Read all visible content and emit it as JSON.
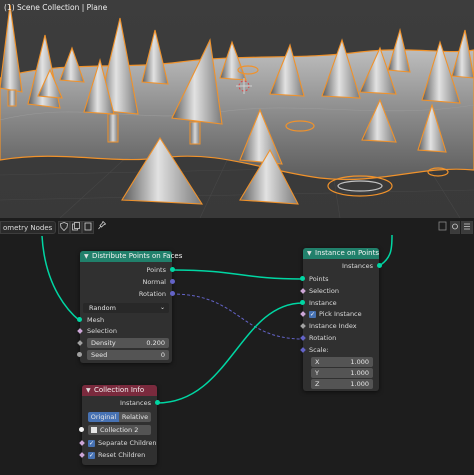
{
  "viewport": {
    "title": "(1) Scene Collection | Plane"
  },
  "node_header": {
    "tree_name": "ometry Nodes",
    "buttons": [
      "shield-icon",
      "copy-icon",
      "new-icon",
      "pin-icon"
    ]
  },
  "nodes": {
    "distribute": {
      "title": "Distribute Points on Faces",
      "header_color": "#21806b",
      "outputs": [
        "Points",
        "Normal",
        "Rotation"
      ],
      "mode": "Random",
      "inputs": {
        "mesh": "Mesh",
        "selection": "Selection"
      },
      "density": {
        "label": "Density",
        "value": "0.200"
      },
      "seed": {
        "label": "Seed",
        "value": "0"
      }
    },
    "instance": {
      "title": "Instance on Points",
      "header_color": "#21806b",
      "output": "Instances",
      "inputs": [
        "Points",
        "Selection",
        "Instance"
      ],
      "pick_instance": "Pick Instance",
      "more_inputs": [
        "Instance Index",
        "Rotation",
        "Scale:"
      ],
      "scale": [
        {
          "axis": "X",
          "value": "1.000"
        },
        {
          "axis": "Y",
          "value": "1.000"
        },
        {
          "axis": "Z",
          "value": "1.000"
        }
      ]
    },
    "collection": {
      "title": "Collection Info",
      "header_color": "#7a2a3d",
      "output": "Instances",
      "tabs": [
        "Original",
        "Relative"
      ],
      "collection_name": "Collection 2",
      "separate_children": "Separate Children",
      "reset_children": "Reset Children"
    }
  },
  "colors": {
    "geometry_socket": "#00d6a3",
    "vector_socket": "#6363c7",
    "selection_orange": "#f0922b",
    "active_blue": "#4772b3"
  }
}
